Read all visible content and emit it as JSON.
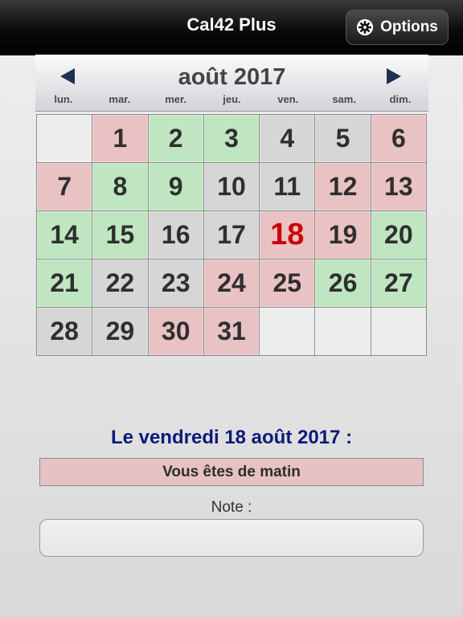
{
  "app": {
    "title": "Cal42 Plus",
    "options_label": "Options"
  },
  "calendar": {
    "month_title": "août 2017",
    "weekdays": [
      "lun.",
      "mar.",
      "mer.",
      "jeu.",
      "ven.",
      "sam.",
      "dim."
    ],
    "today": "18",
    "cells": [
      {
        "day": "",
        "status": "empty"
      },
      {
        "day": "1",
        "status": "pink"
      },
      {
        "day": "2",
        "status": "green"
      },
      {
        "day": "3",
        "status": "green"
      },
      {
        "day": "4",
        "status": "grey"
      },
      {
        "day": "5",
        "status": "grey"
      },
      {
        "day": "6",
        "status": "pink"
      },
      {
        "day": "7",
        "status": "pink"
      },
      {
        "day": "8",
        "status": "green"
      },
      {
        "day": "9",
        "status": "green"
      },
      {
        "day": "10",
        "status": "grey"
      },
      {
        "day": "11",
        "status": "grey"
      },
      {
        "day": "12",
        "status": "pink"
      },
      {
        "day": "13",
        "status": "pink"
      },
      {
        "day": "14",
        "status": "green"
      },
      {
        "day": "15",
        "status": "green"
      },
      {
        "day": "16",
        "status": "grey"
      },
      {
        "day": "17",
        "status": "grey"
      },
      {
        "day": "18",
        "status": "pink"
      },
      {
        "day": "19",
        "status": "pink"
      },
      {
        "day": "20",
        "status": "green"
      },
      {
        "day": "21",
        "status": "green"
      },
      {
        "day": "22",
        "status": "grey"
      },
      {
        "day": "23",
        "status": "grey"
      },
      {
        "day": "24",
        "status": "pink"
      },
      {
        "day": "25",
        "status": "pink"
      },
      {
        "day": "26",
        "status": "green"
      },
      {
        "day": "27",
        "status": "green"
      },
      {
        "day": "28",
        "status": "grey"
      },
      {
        "day": "29",
        "status": "grey"
      },
      {
        "day": "30",
        "status": "pink"
      },
      {
        "day": "31",
        "status": "pink"
      },
      {
        "day": "",
        "status": "empty"
      },
      {
        "day": "",
        "status": "empty"
      },
      {
        "day": "",
        "status": "empty"
      }
    ]
  },
  "selection": {
    "date_heading": "Le vendredi 18 août 2017 :",
    "status_text": "Vous êtes de matin",
    "note_label": "Note :",
    "note_value": ""
  },
  "icons": {
    "options": "gear-icon",
    "prev": "triangle-left-icon",
    "next": "triangle-right-icon"
  },
  "colors": {
    "green": "#bfe6c1",
    "pink": "#e9c2c4",
    "grey": "#d6d6d6",
    "today": "#cc0000",
    "heading": "#0c1a7a"
  }
}
